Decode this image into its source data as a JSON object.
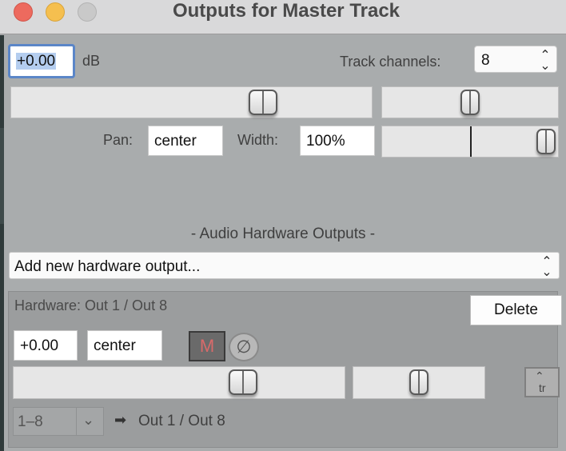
{
  "window": {
    "title": "Outputs for Master Track"
  },
  "master": {
    "volume_value": "+0.00",
    "volume_unit": "dB",
    "track_channels_label": "Track channels:",
    "track_channels_value": "8",
    "pan_label": "Pan:",
    "pan_value": "center",
    "width_label": "Width:",
    "width_value": "100%"
  },
  "hardware": {
    "section_title": "-  Audio Hardware Outputs  -",
    "add_output_placeholder": "Add new hardware output...",
    "output": {
      "title": "Hardware: Out 1 / Out 8",
      "delete_label": "Delete",
      "volume_value": "+0.00",
      "pan_value": "center",
      "mute_label": "M",
      "phase_label": "∅",
      "channel_range": "1–8",
      "arrow": "➡",
      "destination": "Out 1 / Out 8",
      "tr_label": "tr"
    }
  },
  "icons": {
    "updown": "up-down-chevron-icon",
    "arrow": "arrow-right-icon"
  },
  "colors": {
    "window_bg": "#a9acad",
    "focus_ring": "#5b86c8",
    "mute_text": "#d86a6a"
  }
}
